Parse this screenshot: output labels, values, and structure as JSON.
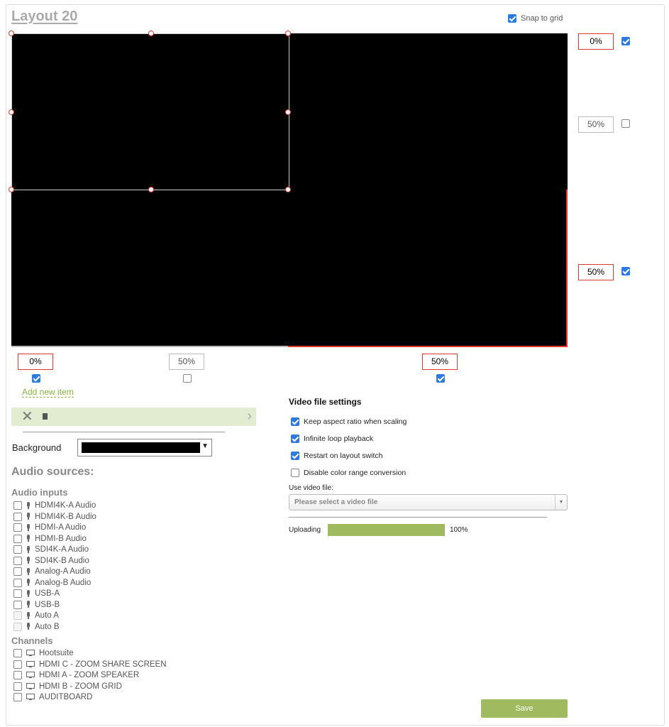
{
  "layout_title": "Layout 20",
  "snap_to_grid": {
    "label": "Snap to grid",
    "checked": true
  },
  "right_percents": [
    {
      "value": "0%",
      "checked": true
    },
    {
      "value": "50%",
      "checked": false
    },
    {
      "value": "50%",
      "checked": true
    }
  ],
  "bottom_percents": [
    {
      "value": "0%",
      "checked": true
    },
    {
      "value": "50%",
      "checked": false
    },
    {
      "value": "50%",
      "checked": true
    }
  ],
  "add_new_item": "Add new item",
  "background": {
    "label": "Background",
    "color": "#000000"
  },
  "audio_sources": {
    "heading": "Audio sources:",
    "inputs_heading": "Audio inputs",
    "inputs": [
      {
        "label": "HDMI4K-A Audio",
        "enabled": true
      },
      {
        "label": "HDMI4K-B Audio",
        "enabled": true
      },
      {
        "label": "HDMI-A Audio",
        "enabled": true
      },
      {
        "label": "HDMI-B Audio",
        "enabled": true
      },
      {
        "label": "SDI4K-A Audio",
        "enabled": true
      },
      {
        "label": "SDI4K-B Audio",
        "enabled": true
      },
      {
        "label": "Analog-A Audio",
        "enabled": true
      },
      {
        "label": "Analog-B Audio",
        "enabled": true
      },
      {
        "label": "USB-A",
        "enabled": true
      },
      {
        "label": "USB-B",
        "enabled": true
      },
      {
        "label": "Auto A",
        "enabled": false
      },
      {
        "label": "Auto B",
        "enabled": false
      }
    ],
    "channels_heading": "Channels",
    "channels": [
      {
        "label": "Hootsuite"
      },
      {
        "label": "HDMI C - ZOOM SHARE SCREEN"
      },
      {
        "label": "HDMI A - ZOOM SPEAKER"
      },
      {
        "label": "HDMI B - ZOOM GRID"
      },
      {
        "label": "AUDITBOARD"
      }
    ]
  },
  "video_settings": {
    "heading": "Video file settings",
    "options": [
      {
        "label": "Keep aspect ratio when scaling",
        "checked": true
      },
      {
        "label": "Infinite loop playback",
        "checked": true
      },
      {
        "label": "Restart on layout switch",
        "checked": true
      },
      {
        "label": "Disable color range conversion",
        "checked": false
      }
    ],
    "use_file_label": "Use video file:",
    "file_placeholder": "Please select a video file",
    "uploading_label": "Uploading",
    "upload_progress": 1.0,
    "upload_percent": "100%"
  },
  "save_label": "Save",
  "colors": {
    "accent_green": "#9fba5f",
    "selection_red": "#e0392b",
    "checkbox_blue": "#2d7ae0"
  }
}
